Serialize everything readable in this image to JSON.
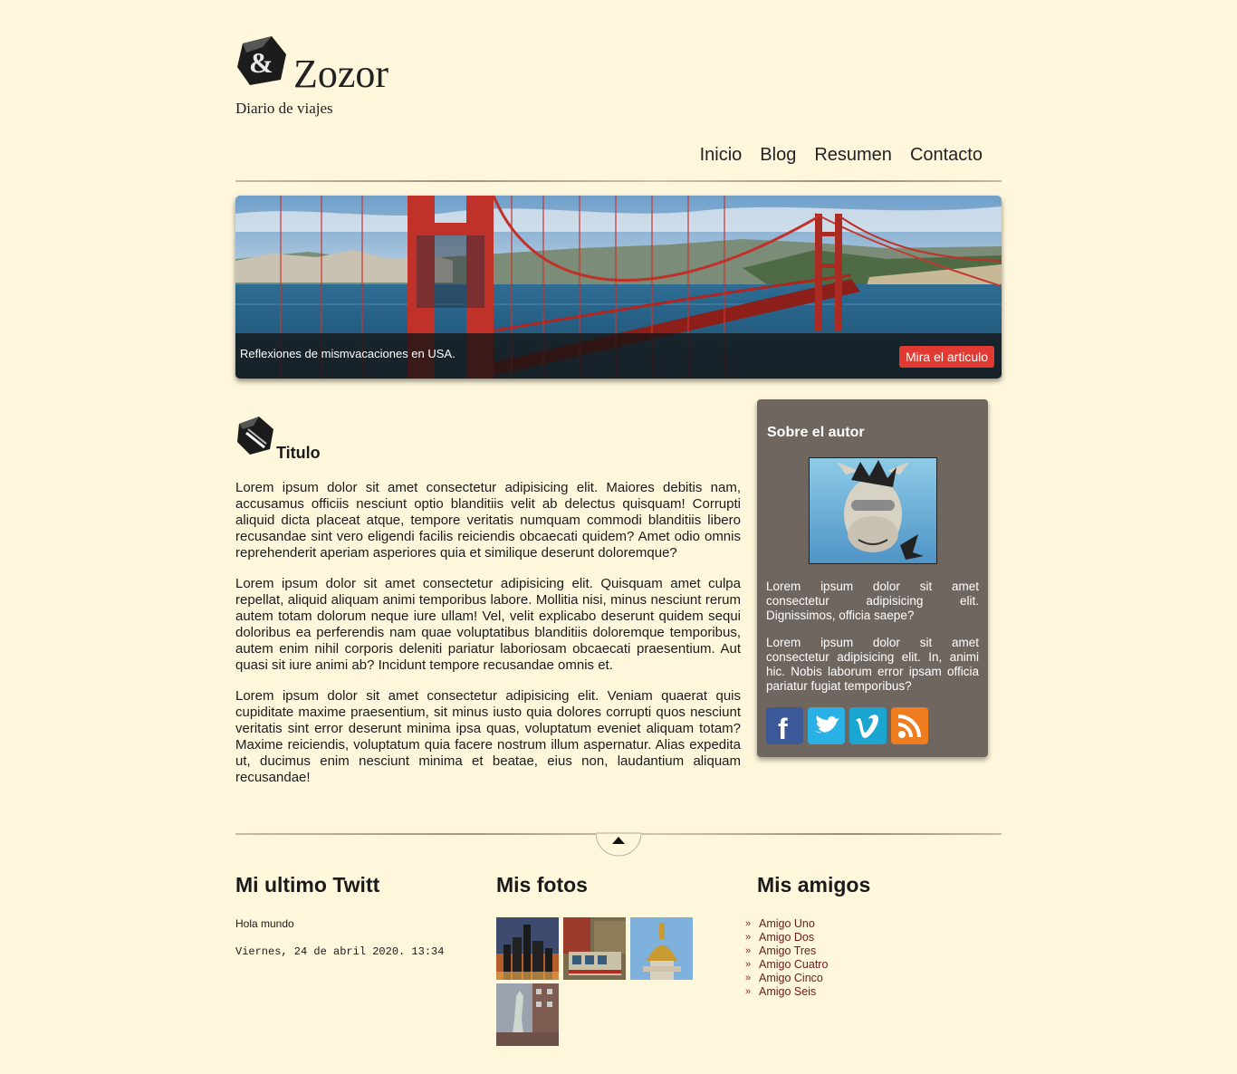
{
  "site": {
    "brand": "Zozor",
    "tagline": "Diario de viajes"
  },
  "nav": [
    "Inicio",
    "Blog",
    "Resumen",
    "Contacto"
  ],
  "banner": {
    "caption": "Reflexiones de mismvacaciones en USA.",
    "button": "Mira el articulo"
  },
  "article": {
    "title": "Titulo",
    "paragraphs": [
      "Lorem ipsum dolor sit amet consectetur adipisicing elit. Maiores debitis nam, accusamus officiis nesciunt optio blanditiis velit ab delectus quisquam! Corrupti aliquid dicta placeat atque, tempore veritatis numquam commodi blanditiis libero recusandae sint vero eligendi facilis reiciendis obcaecati quidem? Amet odio omnis reprehenderit aperiam asperiores quia et similique deserunt doloremque?",
      "Lorem ipsum dolor sit amet consectetur adipisicing elit. Quisquam amet culpa repellat, aliquid aliquam animi temporibus labore. Mollitia nisi, minus nesciunt rerum autem totam dolorum neque iure ullam! Vel, velit explicabo deserunt quidem sequi doloribus ea perferendis nam quae voluptatibus blanditiis doloremque temporibus, autem enim nihil corporis deleniti pariatur laboriosam obcaecati praesentium. Aut quasi sit iure animi ab? Incidunt tempore recusandae omnis et.",
      "Lorem ipsum dolor sit amet consectetur adipisicing elit. Veniam quaerat quis cupiditate maxime praesentium, sit minus iusto quia dolores corrupti quos nesciunt veritatis sint error deserunt minima ipsa quas, voluptatum eveniet aliquam totam? Maxime reiciendis, voluptatum quia facere nostrum illum aspernatur. Alias expedita ut, ducimus enim nesciunt minima et beatae, eius non, laudantium aliquam recusandae!"
    ]
  },
  "sidebar": {
    "title": "Sobre el autor",
    "p1": "Lorem ipsum dolor sit amet consectetur adipisicing elit. Dignissimos, officia saepe?",
    "p2": "Lorem ipsum dolor sit amet consectetur adipisicing elit. In, animi hic. Nobis laborum error ipsam officia pariatur fugiat temporibus?",
    "socials": [
      "facebook-icon",
      "twitter-icon",
      "vimeo-icon",
      "rss-icon"
    ]
  },
  "footer": {
    "twitter": {
      "title": "Mi ultimo Twitt",
      "text": "Hola mundo",
      "date": "Viernes, 24 de abril 2020. 13:34"
    },
    "photos": {
      "title": "Mis fotos"
    },
    "friends": {
      "title": "Mis amigos",
      "items": [
        "Amigo Uno",
        "Amigo Dos",
        "Amigo Tres",
        "Amigo Cuatro",
        "Amigo Cinco",
        "Amigo Seis"
      ]
    }
  },
  "colors": {
    "background": "#fff7dc",
    "sidebar": "#6f6660",
    "button": "#e03a32",
    "friend_link": "#6b1b1b"
  }
}
